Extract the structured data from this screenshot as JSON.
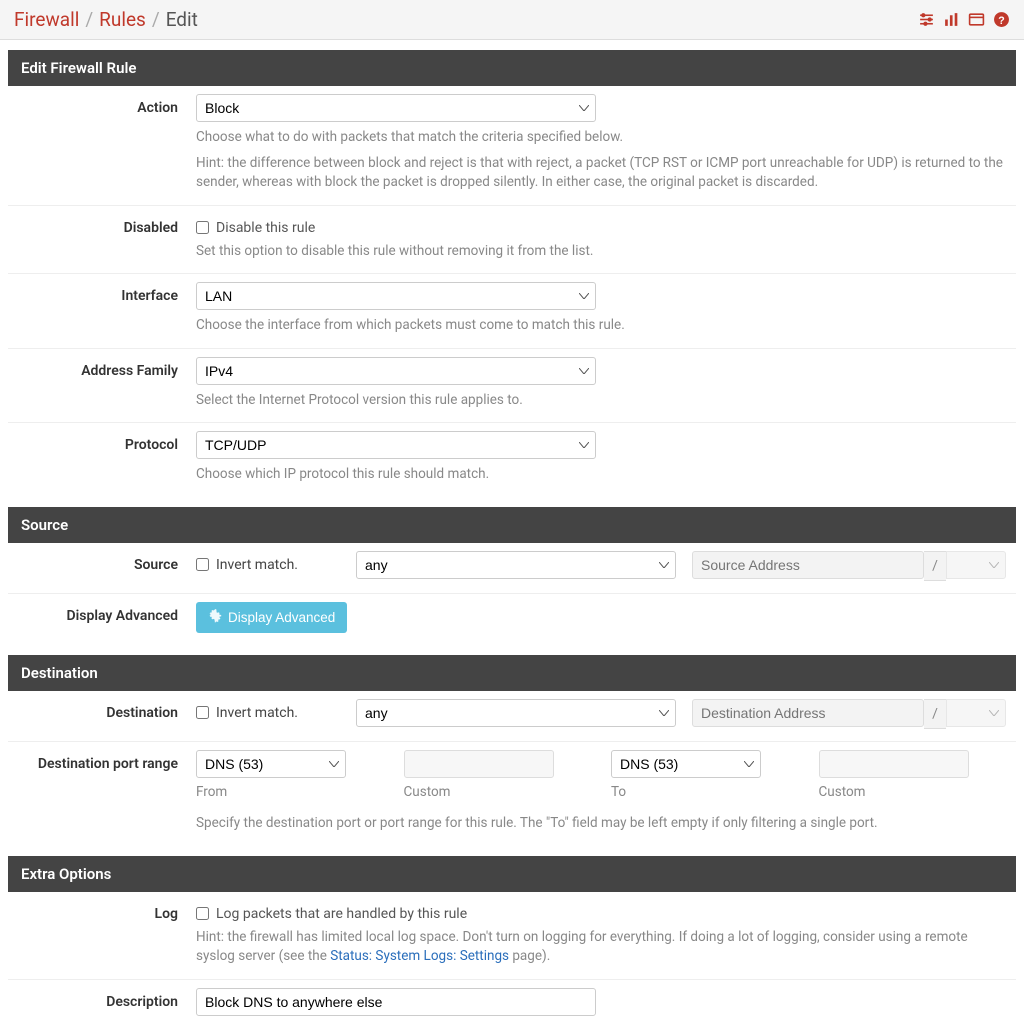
{
  "breadcrumbs": {
    "firewall": "Firewall",
    "rules": "Rules",
    "edit": "Edit"
  },
  "panels": {
    "edit": {
      "title": "Edit Firewall Rule",
      "action": {
        "label": "Action",
        "value": "Block",
        "help1": "Choose what to do with packets that match the criteria specified below.",
        "help2": "Hint: the difference between block and reject is that with reject, a packet (TCP RST or ICMP port unreachable for UDP) is returned to the sender, whereas with block the packet is dropped silently. In either case, the original packet is discarded."
      },
      "disabled": {
        "label": "Disabled",
        "check_label": "Disable this rule",
        "help": "Set this option to disable this rule without removing it from the list."
      },
      "interface": {
        "label": "Interface",
        "value": "LAN",
        "help": "Choose the interface from which packets must come to match this rule."
      },
      "address_family": {
        "label": "Address Family",
        "value": "IPv4",
        "help": "Select the Internet Protocol version this rule applies to."
      },
      "protocol": {
        "label": "Protocol",
        "value": "TCP/UDP",
        "help": "Choose which IP protocol this rule should match."
      }
    },
    "source": {
      "title": "Source",
      "row_label": "Source",
      "invert_label": "Invert match.",
      "type_value": "any",
      "addr_placeholder": "Source Address",
      "mask_sep": "/",
      "advanced_label": "Display Advanced",
      "advanced_button": "Display Advanced"
    },
    "destination": {
      "title": "Destination",
      "row_label": "Destination",
      "invert_label": "Invert match.",
      "type_value": "any",
      "addr_placeholder": "Destination Address",
      "mask_sep": "/",
      "port_label": "Destination port range",
      "from_value": "DNS (53)",
      "from_label": "From",
      "custom1_value": "",
      "custom1_label": "Custom",
      "to_value": "DNS (53)",
      "to_label": "To",
      "custom2_value": "",
      "custom2_label": "Custom",
      "help": "Specify the destination port or port range for this rule. The \"To\" field may be left empty if only filtering a single port."
    },
    "extra": {
      "title": "Extra Options",
      "log": {
        "label": "Log",
        "check_label": "Log packets that are handled by this rule",
        "help_pre": "Hint: the firewall has limited local log space. Don't turn on logging for everything. If doing a lot of logging, consider using a remote syslog server (see the ",
        "help_link": "Status: System Logs: Settings",
        "help_post": " page)."
      },
      "description": {
        "label": "Description",
        "value": "Block DNS to anywhere else"
      }
    }
  }
}
